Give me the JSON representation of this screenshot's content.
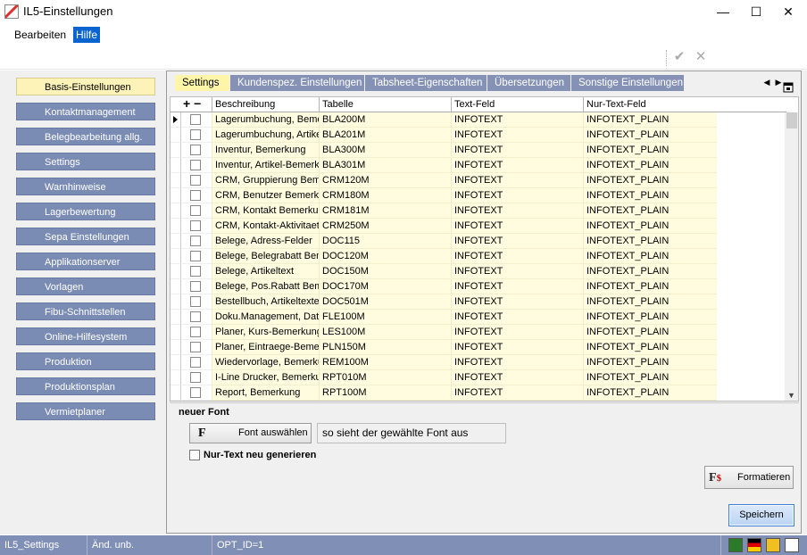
{
  "window": {
    "title": "IL5-Einstellungen",
    "minimize": "—",
    "maximize": "☐",
    "close": "✕"
  },
  "menu": {
    "items": [
      {
        "label": "Bearbeiten"
      },
      {
        "label": "Hilfe"
      }
    ]
  },
  "toolbar": {
    "confirm_icon": "✔",
    "cancel_icon": "✕"
  },
  "nav": {
    "items": [
      {
        "label": "Basis-Einstellungen",
        "active": true
      },
      {
        "label": "Kontaktmanagement"
      },
      {
        "label": "Belegbearbeitung allg."
      },
      {
        "label": "Settings"
      },
      {
        "label": "Warnhinweise"
      },
      {
        "label": "Lagerbewertung"
      },
      {
        "label": "Sepa Einstellungen"
      },
      {
        "label": "Applikationserver"
      },
      {
        "label": "Vorlagen"
      },
      {
        "label": "Fibu-Schnittstellen"
      },
      {
        "label": "Online-Hilfesystem"
      },
      {
        "label": "Produktion"
      },
      {
        "label": "Produktionsplan"
      },
      {
        "label": "Vermietplaner"
      }
    ]
  },
  "tabs": [
    {
      "label": "Settings",
      "active": true
    },
    {
      "label": "Kundenspez. Einstellungen"
    },
    {
      "label": "Tabsheet-Eigenschaften"
    },
    {
      "label": "Übersetzungen"
    },
    {
      "label": "Sonstige Einstellungen"
    }
  ],
  "tab_scroll": {
    "left": "◀",
    "right": "▶"
  },
  "grid": {
    "plus_minus": "+ −",
    "columns": [
      "Beschreibung",
      "Tabelle",
      "Text-Feld",
      "Nur-Text-Feld"
    ],
    "rows": [
      [
        "Lagerumbuchung, Bemerkung",
        "BLA200M",
        "INFOTEXT",
        "INFOTEXT_PLAIN"
      ],
      [
        "Lagerumbuchung, Artikeltext",
        "BLA201M",
        "INFOTEXT",
        "INFOTEXT_PLAIN"
      ],
      [
        "Inventur, Bemerkung",
        "BLA300M",
        "INFOTEXT",
        "INFOTEXT_PLAIN"
      ],
      [
        "Inventur, Artikel-Bemerkung",
        "BLA301M",
        "INFOTEXT",
        "INFOTEXT_PLAIN"
      ],
      [
        "CRM, Gruppierung Bemerkung",
        "CRM120M",
        "INFOTEXT",
        "INFOTEXT_PLAIN"
      ],
      [
        "CRM, Benutzer Bemerkung",
        "CRM180M",
        "INFOTEXT",
        "INFOTEXT_PLAIN"
      ],
      [
        "CRM, Kontakt Bemerkung",
        "CRM181M",
        "INFOTEXT",
        "INFOTEXT_PLAIN"
      ],
      [
        "CRM, Kontakt-Aktivitaet",
        "CRM250M",
        "INFOTEXT",
        "INFOTEXT_PLAIN"
      ],
      [
        "Belege, Adress-Felder",
        "DOC115",
        "INFOTEXT",
        "INFOTEXT_PLAIN"
      ],
      [
        "Belege, Belegrabatt Bemerkung",
        "DOC120M",
        "INFOTEXT",
        "INFOTEXT_PLAIN"
      ],
      [
        "Belege, Artikeltext",
        "DOC150M",
        "INFOTEXT",
        "INFOTEXT_PLAIN"
      ],
      [
        "Belege, Pos.Rabatt Bemerkung",
        "DOC170M",
        "INFOTEXT",
        "INFOTEXT_PLAIN"
      ],
      [
        "Bestellbuch, Artikeltexte",
        "DOC501M",
        "INFOTEXT",
        "INFOTEXT_PLAIN"
      ],
      [
        "Doku.Management, Datei",
        "FLE100M",
        "INFOTEXT",
        "INFOTEXT_PLAIN"
      ],
      [
        "Planer, Kurs-Bemerkung",
        "LES100M",
        "INFOTEXT",
        "INFOTEXT_PLAIN"
      ],
      [
        "Planer, Eintraege-Bemerkung",
        "PLN150M",
        "INFOTEXT",
        "INFOTEXT_PLAIN"
      ],
      [
        "Wiedervorlage, Bemerkung",
        "REM100M",
        "INFOTEXT",
        "INFOTEXT_PLAIN"
      ],
      [
        "I-Line Drucker, Bemerkung",
        "RPT010M",
        "INFOTEXT",
        "INFOTEXT_PLAIN"
      ],
      [
        "Report, Bemerkung",
        "RPT100M",
        "INFOTEXT",
        "INFOTEXT_PLAIN"
      ]
    ]
  },
  "lower": {
    "section_title": "neuer Font",
    "font_button_icon": "F",
    "font_button_label": "Font auswählen",
    "font_preview": "so sieht der gewählte Font aus",
    "regen_checkbox_label": "Nur-Text neu generieren",
    "format_button_icon": "F",
    "format_button_label": "Formatieren",
    "save_button_label": "Speichern"
  },
  "statusbar": {
    "cells": [
      "IL5_Settings",
      "Änd. unb.",
      "OPT_ID=1"
    ]
  },
  "colors": {
    "nav_bg": "#7a8bb4",
    "nav_active": "#fdf3b8",
    "tab_bg": "#8592b5",
    "tab_active": "#fff5a8",
    "cell_bg": "#fffce0",
    "statusbar_bg": "#7f8fb5",
    "menu_active": "#0a64d0"
  }
}
